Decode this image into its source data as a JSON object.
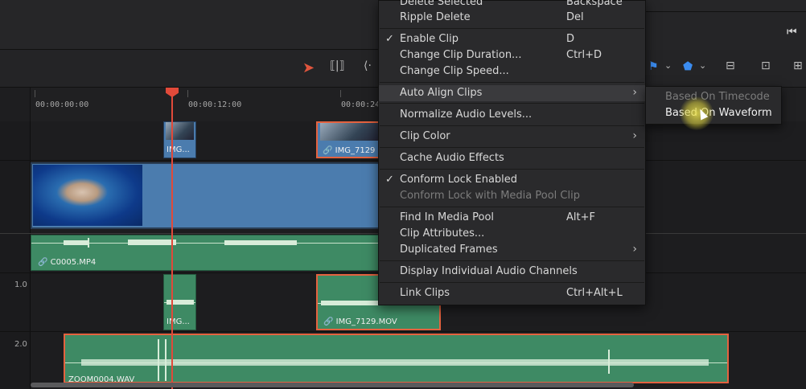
{
  "ruler": {
    "timecodes": [
      "00:00:00:00",
      "00:00:12:00",
      "00:00:24"
    ]
  },
  "tracks": {
    "audio_labels": [
      "1.0",
      "2.0"
    ]
  },
  "clips": {
    "v2_clip1_name": "IMG...",
    "v2_clip2_name": "IMG_7129",
    "a1_name": "C0005.MP4",
    "a2_clip1_name": "IMG...",
    "a2_clip2_name": "IMG_7129.MOV",
    "a3_name": "ZOOM0004.WAV"
  },
  "menu": {
    "items": [
      {
        "label": "Delete Selected",
        "shortcut": "Backspace"
      },
      {
        "label": "Ripple Delete",
        "shortcut": "Del"
      },
      {
        "label": "Enable Clip",
        "shortcut": "D",
        "checked": true
      },
      {
        "label": "Change Clip Duration...",
        "shortcut": "Ctrl+D"
      },
      {
        "label": "Change Clip Speed..."
      },
      {
        "label": "Auto Align Clips",
        "submenu": true,
        "highlighted": true
      },
      {
        "label": "Normalize Audio Levels..."
      },
      {
        "label": "Clip Color",
        "submenu": true
      },
      {
        "label": "Cache Audio Effects"
      },
      {
        "label": "Conform Lock Enabled",
        "checked": true
      },
      {
        "label": "Conform Lock with Media Pool Clip",
        "disabled": true
      },
      {
        "label": "Find In Media Pool",
        "shortcut": "Alt+F"
      },
      {
        "label": "Clip Attributes..."
      },
      {
        "label": "Duplicated Frames",
        "submenu": true
      },
      {
        "label": "Display Individual Audio Channels"
      },
      {
        "label": "Link Clips",
        "shortcut": "Ctrl+Alt+L"
      }
    ],
    "check_glyph": "✓",
    "submenu_glyph": "›"
  },
  "submenu": {
    "items": [
      {
        "label": "Based On Timecode",
        "disabled": true
      },
      {
        "label": "Based On Waveform"
      }
    ]
  },
  "colors": {
    "playhead": "#e14a3a",
    "video_clip": "#4b7cae",
    "audio_clip": "#3e8a64",
    "selection": "#e4623f"
  }
}
